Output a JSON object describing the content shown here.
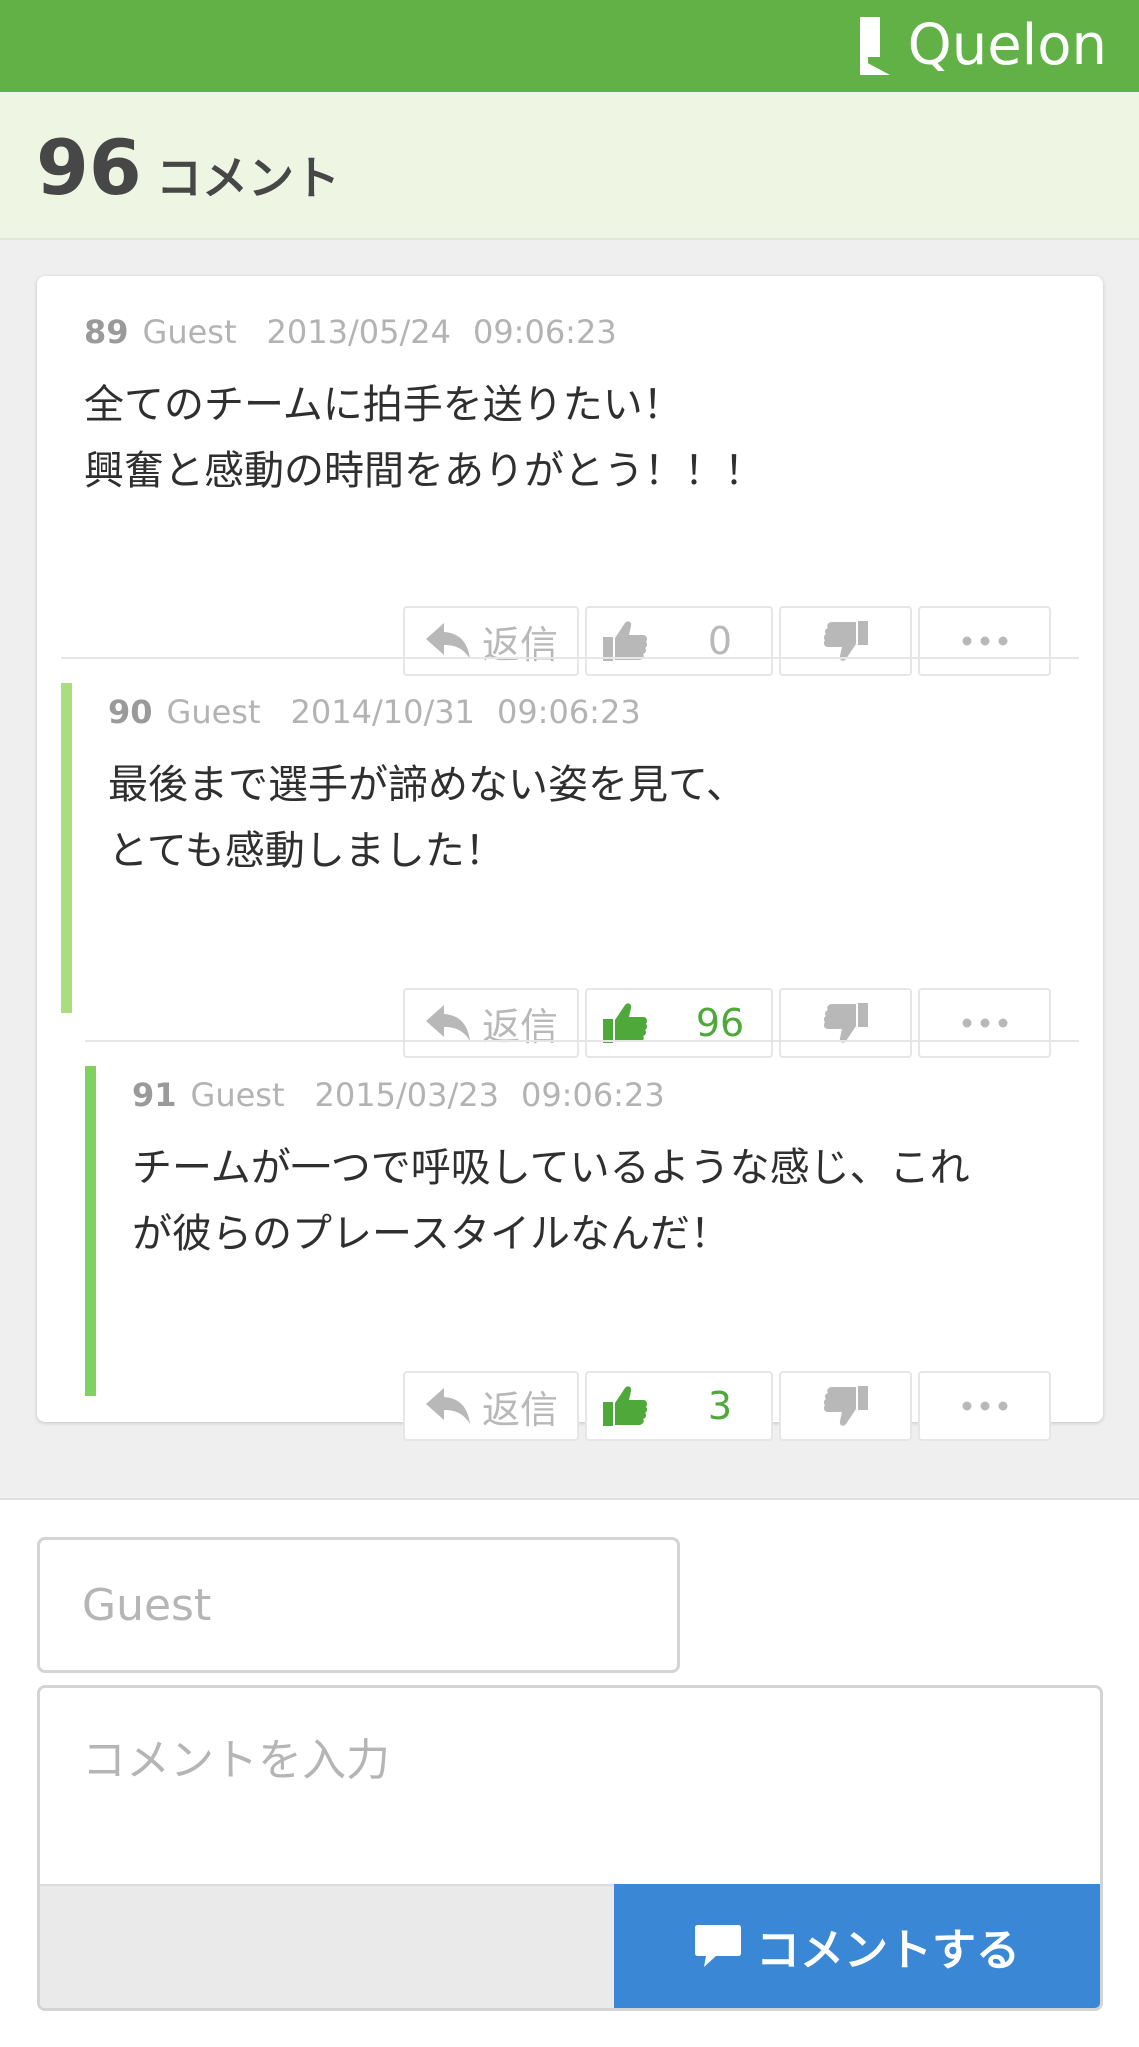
{
  "header": {
    "brand_name": "Quelon",
    "brand_color": "#62b146"
  },
  "summary": {
    "count": "96",
    "label": "コメント"
  },
  "comments": [
    {
      "number": "89",
      "user": "Guest",
      "date": "2013/05/24",
      "time": "09:06:23",
      "text": "全てのチームに拍手を送りたい！\n興奮と感動の時間をありがとう！！！",
      "reply_label": "返信",
      "likes": "0",
      "liked": false,
      "accent": false
    },
    {
      "number": "90",
      "user": "Guest",
      "date": "2014/10/31",
      "time": "09:06:23",
      "text": "最後まで選手が諦めない姿を見て、\nとても感動しました！",
      "reply_label": "返信",
      "likes": "96",
      "liked": true,
      "accent": true,
      "accent_color": "#a8de7c"
    },
    {
      "number": "91",
      "user": "Guest",
      "date": "2015/03/23",
      "time": "09:06:23",
      "text": "チームが一つで呼吸しているような感じ、これ\nが彼らのプレースタイルなんだ！",
      "reply_label": "返信",
      "likes": "3",
      "liked": true,
      "accent": true,
      "accent_color": "#7fd262"
    }
  ],
  "icons": {
    "reply": "reply-arrow-icon",
    "like": "thumbs-up-icon",
    "dislike": "thumbs-down-icon",
    "more": "ellipsis-icon",
    "submit": "speech-bubble-icon"
  },
  "form": {
    "name_placeholder": "Guest",
    "comment_placeholder": "コメントを入力",
    "submit_label": "コメントする",
    "submit_color": "#3a87d6"
  }
}
